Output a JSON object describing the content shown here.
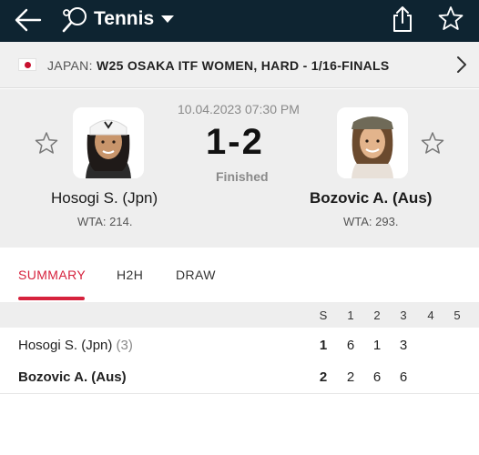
{
  "header": {
    "title": "Tennis",
    "icons": [
      "back-arrow-icon",
      "tennis-racket-icon",
      "dropdown-caret-icon",
      "share-icon",
      "star-icon"
    ]
  },
  "tournament": {
    "country": "JAPAN:",
    "name": "W25 OSAKA ITF WOMEN, HARD - 1/16-FINALS"
  },
  "match": {
    "datetime": "10.04.2023 07:30 PM",
    "score": "1-2",
    "status": "Finished",
    "home": {
      "name": "Hosogi S. (Jpn)",
      "rank": "WTA: 214."
    },
    "away": {
      "name": "Bozovic A. (Aus)",
      "rank": "WTA: 293."
    }
  },
  "tabs": [
    "SUMMARY",
    "H2H",
    "DRAW"
  ],
  "scoreboard": {
    "columns": [
      "S",
      "1",
      "2",
      "3",
      "4",
      "5"
    ],
    "rows": [
      {
        "name": "Hosogi S. (Jpn)",
        "seed": "(3)",
        "sets": "1",
        "s1": "6",
        "s2": "1",
        "s3": "3"
      },
      {
        "name": "Bozovic A. (Aus)",
        "seed": "",
        "sets": "2",
        "s1": "2",
        "s2": "6",
        "s3": "6"
      }
    ]
  },
  "colors": {
    "topbar": "#0e2431",
    "accent": "#d6223d",
    "header_bg": "#eeeeee"
  }
}
